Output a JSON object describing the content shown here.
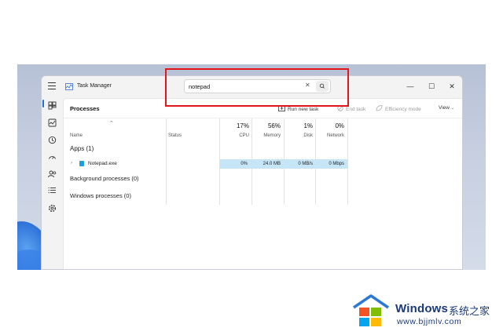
{
  "window": {
    "app_title": "Task Manager",
    "controls": {
      "minimize": "—",
      "maximize": "☐",
      "close": "✕"
    }
  },
  "search": {
    "value": "notepad",
    "clear_glyph": "✕"
  },
  "toolbar": {
    "page_title": "Processes",
    "run_new_task": "Run new task",
    "end_task": "End task",
    "efficiency_mode": "Efficiency mode",
    "view": "View"
  },
  "sidebar": {
    "items": [
      "processes-icon",
      "performance-icon",
      "app-history-icon",
      "startup-apps-icon",
      "users-icon",
      "details-icon",
      "services-icon"
    ]
  },
  "columns": {
    "name": "Name",
    "status": "Status",
    "cpu": {
      "pct": "17%",
      "label": "CPU"
    },
    "memory": {
      "pct": "56%",
      "label": "Memory"
    },
    "disk": {
      "pct": "1%",
      "label": "Disk"
    },
    "network": {
      "pct": "0%",
      "label": "Network"
    }
  },
  "groups": {
    "apps": "Apps (1)",
    "background": "Background processes (0)",
    "windows": "Windows processes (0)"
  },
  "process_row": {
    "name": "Notepad.exe",
    "cpu": "0%",
    "memory": "24.0 MB",
    "disk": "0 MB/s",
    "network": "0 Mbps"
  },
  "watermark": {
    "title": "Windows",
    "chinese": "系统之家",
    "url": "www.bjjmlv.com"
  },
  "colors": {
    "highlight": "#e3161b",
    "selection": "#c6e6f7",
    "accent": "#1f6fd6"
  }
}
